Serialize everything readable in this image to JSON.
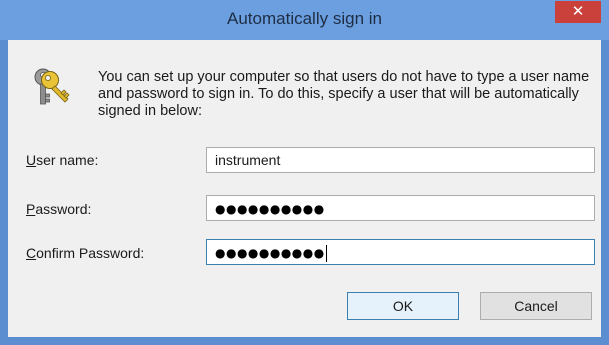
{
  "window": {
    "title": "Automatically sign in",
    "close_glyph": "✕"
  },
  "intro_text": "You can set up your computer so that users do not have to type a user name and password to sign in. To do this, specify a user that will be automatically signed in below:",
  "icon": "keys-icon",
  "fields": {
    "user_name": {
      "label_access": "U",
      "label_rest": "ser name:",
      "value": "instrument"
    },
    "password": {
      "label_access": "P",
      "label_rest": "assword:",
      "value": "●●●●●●●●●●"
    },
    "confirm_password": {
      "label_access": "C",
      "label_rest": "onfirm Password:",
      "value": "●●●●●●●●●●"
    }
  },
  "buttons": {
    "ok": "OK",
    "cancel": "Cancel"
  },
  "colors": {
    "titlebar": "#6b9fe0",
    "close": "#c9413a",
    "client": "#f0f0f0",
    "focus_border": "#3c7fb1"
  }
}
